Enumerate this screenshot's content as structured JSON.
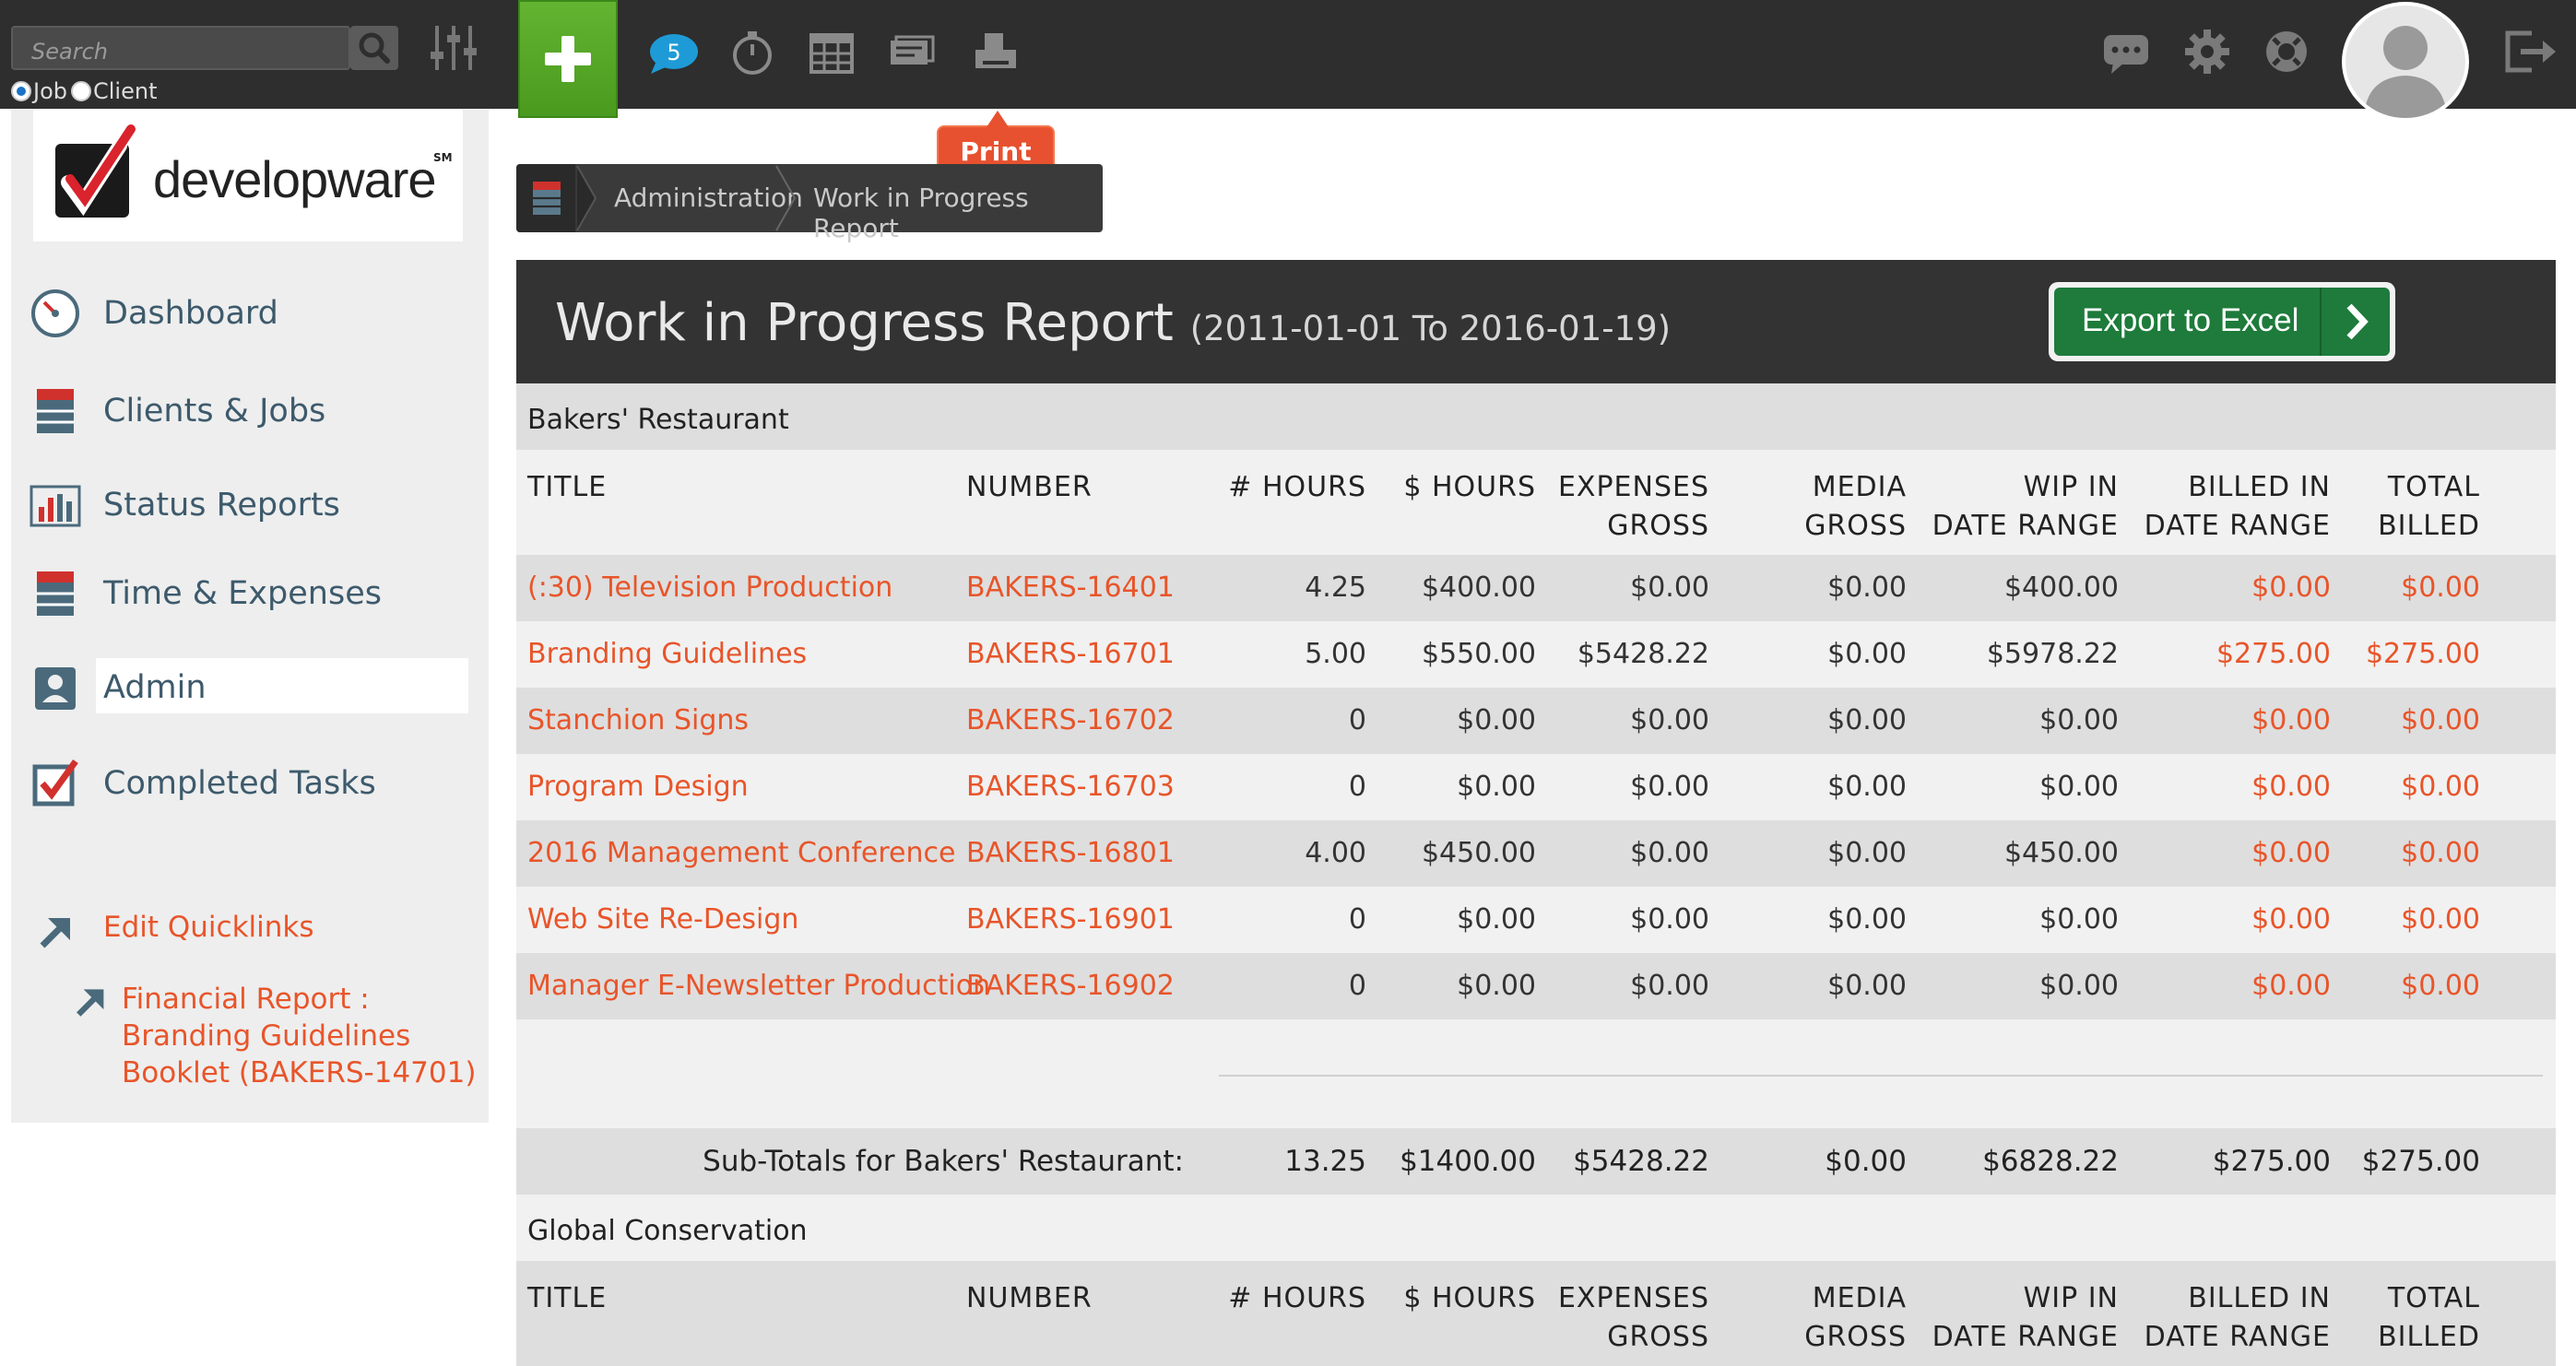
{
  "topbar": {
    "search_placeholder": "Search",
    "radio_job": "Job",
    "radio_client": "Client",
    "message_count": "5",
    "tooltip": "Print",
    "icons": [
      "filter-icon",
      "add-icon",
      "messages-icon",
      "timer-icon",
      "calendar-icon",
      "invoice-icon",
      "print-icon",
      "chat-icon",
      "settings-icon",
      "help-icon",
      "avatar-icon",
      "logout-icon"
    ]
  },
  "sidebar": {
    "logo_text": "developware",
    "logo_sm": "SM",
    "items": [
      {
        "label": "Dashboard",
        "icon": "gauge-icon"
      },
      {
        "label": "Clients & Jobs",
        "icon": "cabinet-icon"
      },
      {
        "label": "Status Reports",
        "icon": "bar-chart-icon"
      },
      {
        "label": "Time & Expenses",
        "icon": "cabinet-icon"
      },
      {
        "label": "Admin",
        "icon": "id-badge-icon"
      },
      {
        "label": "Completed Tasks",
        "icon": "checkbox-icon"
      }
    ],
    "quicklinks_label": "Edit Quicklinks",
    "quicklink_1": "Financial Report : Branding Guidelines Booklet (BAKERS-14701)"
  },
  "breadcrumb": {
    "items": [
      "Administration",
      "Work in Progress Report"
    ]
  },
  "report": {
    "title": "Work in Progress Report",
    "range": "(2011-01-01 To 2016-01-19)",
    "export_label": "Export to Excel"
  },
  "columns": {
    "title": "TITLE",
    "number": "NUMBER",
    "hours": "# HOURS",
    "dollar_hours": "$ HOURS",
    "expenses_1": "EXPENSES",
    "expenses_2": "GROSS",
    "media_1": "MEDIA",
    "media_2": "GROSS",
    "wip_1": "WIP IN",
    "wip_2": "DATE RANGE",
    "billed_1": "BILLED IN",
    "billed_2": "DATE RANGE",
    "total_1": "TOTAL",
    "total_2": "BILLED"
  },
  "groups": [
    {
      "name": "Bakers' Restaurant",
      "rows": [
        {
          "title": "(:30) Television Production",
          "number": "BAKERS-16401",
          "hours": "4.25",
          "dollar_hours": "$400.00",
          "expenses": "$0.00",
          "media": "$0.00",
          "wip": "$400.00",
          "billed": "$0.00",
          "total": "$0.00"
        },
        {
          "title": "Branding Guidelines",
          "number": "BAKERS-16701",
          "hours": "5.00",
          "dollar_hours": "$550.00",
          "expenses": "$5428.22",
          "media": "$0.00",
          "wip": "$5978.22",
          "billed": "$275.00",
          "total": "$275.00"
        },
        {
          "title": "Stanchion Signs",
          "number": "BAKERS-16702",
          "hours": "0",
          "dollar_hours": "$0.00",
          "expenses": "$0.00",
          "media": "$0.00",
          "wip": "$0.00",
          "billed": "$0.00",
          "total": "$0.00"
        },
        {
          "title": "Program Design",
          "number": "BAKERS-16703",
          "hours": "0",
          "dollar_hours": "$0.00",
          "expenses": "$0.00",
          "media": "$0.00",
          "wip": "$0.00",
          "billed": "$0.00",
          "total": "$0.00"
        },
        {
          "title": "2016 Management Conference",
          "number": "BAKERS-16801",
          "hours": "4.00",
          "dollar_hours": "$450.00",
          "expenses": "$0.00",
          "media": "$0.00",
          "wip": "$450.00",
          "billed": "$0.00",
          "total": "$0.00"
        },
        {
          "title": "Web Site Re-Design",
          "number": "BAKERS-16901",
          "hours": "0",
          "dollar_hours": "$0.00",
          "expenses": "$0.00",
          "media": "$0.00",
          "wip": "$0.00",
          "billed": "$0.00",
          "total": "$0.00"
        },
        {
          "title": "Manager E-Newsletter Production",
          "number": "BAKERS-16902",
          "hours": "0",
          "dollar_hours": "$0.00",
          "expenses": "$0.00",
          "media": "$0.00",
          "wip": "$0.00",
          "billed": "$0.00",
          "total": "$0.00"
        }
      ],
      "subtotal": {
        "label": "Sub-Totals for Bakers' Restaurant:",
        "hours": "13.25",
        "dollar_hours": "$1400.00",
        "expenses": "$5428.22",
        "media": "$0.00",
        "wip": "$6828.22",
        "billed": "$275.00",
        "total": "$275.00"
      }
    },
    {
      "name": "Global Conservation"
    }
  ],
  "colors": {
    "accent": "#e8552a",
    "topbar": "#2e2e2e",
    "export_green": "#1e7b3b",
    "add_green": "#4a9a1f"
  }
}
